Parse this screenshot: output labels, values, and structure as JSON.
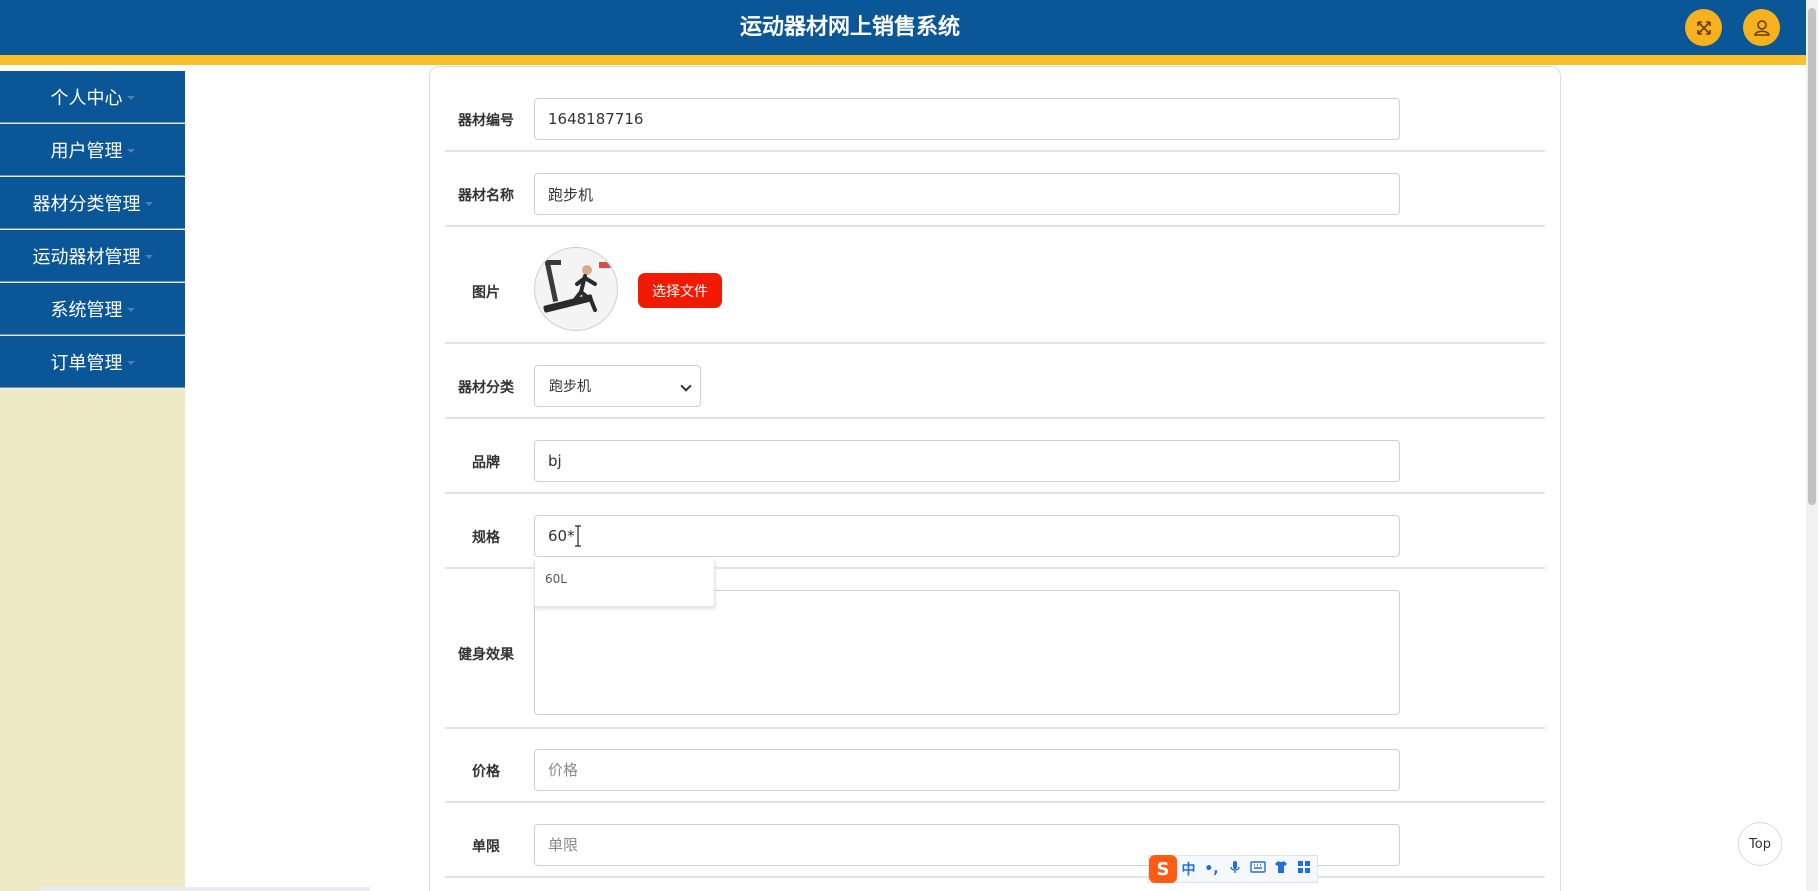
{
  "header": {
    "title": "运动器材网上销售系统",
    "fullscreen_icon": "fullscreen-icon",
    "user_icon": "user-icon",
    "bar_color": "#0b5697",
    "stripe_color": "#f7c12b"
  },
  "sidebar": {
    "items": [
      {
        "label": "个人中心"
      },
      {
        "label": "用户管理"
      },
      {
        "label": "器材分类管理"
      },
      {
        "label": "运动器材管理"
      },
      {
        "label": "系统管理"
      },
      {
        "label": "订单管理"
      }
    ]
  },
  "form": {
    "code": {
      "label": "器材编号",
      "value": "1648187716"
    },
    "name": {
      "label": "器材名称",
      "value": "跑步机"
    },
    "image": {
      "label": "图片",
      "button_label": "选择文件"
    },
    "category": {
      "label": "器材分类",
      "selected": "跑步机"
    },
    "brand": {
      "label": "品牌",
      "value": "bj"
    },
    "spec": {
      "label": "规格",
      "value": "60*",
      "suggestion": "60L"
    },
    "effect": {
      "label": "健身效果",
      "value": ""
    },
    "price": {
      "label": "价格",
      "placeholder": "价格",
      "value": ""
    },
    "limit": {
      "label": "单限",
      "placeholder": "单限",
      "value": ""
    }
  },
  "top_button": {
    "label": "Top"
  },
  "ime_bar": {
    "logo": "S",
    "mode": "中",
    "punct": "•,",
    "icons": [
      "mic-icon",
      "keyboard-icon",
      "shirt-icon",
      "grid-icon"
    ]
  }
}
